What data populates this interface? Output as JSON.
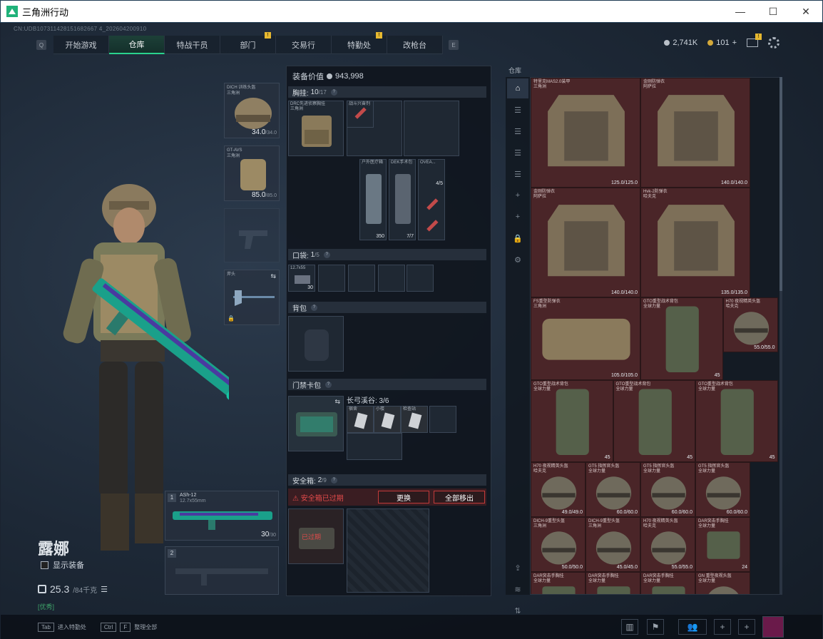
{
  "window": {
    "title": "三角洲行动",
    "min": "—",
    "max": "☐",
    "close": "✕"
  },
  "uid": "CN:UDB107311428151682667 4_202604200910",
  "nav": {
    "left_key": "Q",
    "right_key": "E",
    "tabs": [
      "开始游戏",
      "仓库",
      "特战干员",
      "部门",
      "交易行",
      "特勤处",
      "改枪台"
    ],
    "active": "仓库",
    "badges": {
      "部门": "!",
      "特勤处": "!"
    }
  },
  "currency": {
    "silver": "2,741K",
    "gold": "101",
    "plus": "+",
    "mail_badge": "!"
  },
  "character": {
    "name": "露娜",
    "show_equipment": "显示装备",
    "weight": "25.3",
    "weight_max": "/84千克",
    "green_text": "[优秀]"
  },
  "bottom": {
    "hint1_key": "Tab",
    "hint1": "进入特勤处",
    "hint2_key": "Ctrl",
    "hint2_key2": "F",
    "hint2": "整理全部"
  },
  "equip": {
    "helmet": {
      "label": "DICH 训练头盔\n三角洲",
      "value": "34.0",
      "max": "/34.0"
    },
    "armor": {
      "label": "GT-AVS\n三角洲",
      "value": "85.0",
      "max": "/85.0"
    },
    "melee": {
      "label": "斧头"
    },
    "weapon1": {
      "slot": "1",
      "name": "ASh-12",
      "ammo_type": "12.7x55mm",
      "ammo": "30",
      "ammo_max": "/30"
    },
    "weapon2": {
      "slot": "2"
    }
  },
  "panel": {
    "value_label": "装备价值",
    "value": "943,998",
    "chest": {
      "title": "胸挂:",
      "count": "10",
      "max": "/17"
    },
    "chest_item": "DRC先进侦察胸挂\n三角洲",
    "chest_small": [
      {
        "label": "战斗兴奋剂"
      },
      {
        "label": "户外医疗箱",
        "num": "350"
      },
      {
        "label": "DEK手术包",
        "num": "7/7"
      },
      {
        "label": "OVEA...",
        "num": "4/5"
      }
    ],
    "pocket": {
      "title": "口袋:",
      "count": "1",
      "max": "/5",
      "item": "12.7x55",
      "num": "30"
    },
    "backpack": {
      "title": "背包"
    },
    "keycard": {
      "title": "门禁卡包",
      "sub": "长弓溪谷: 3/6",
      "items": [
        "宿舍",
        "小楼",
        "检查站"
      ]
    },
    "safebox": {
      "title": "安全箱:",
      "count": "2",
      "max": "/9",
      "expired": "安全箱已过期",
      "replace": "更换",
      "remove_all": "全部移出",
      "overlay": "已过期"
    }
  },
  "inventory": {
    "title": "仓库",
    "items": [
      {
        "label": "特里克MAS2.0装甲\n三角洲",
        "num": "125.0/125.0"
      },
      {
        "label": "金刚防弹衣\n阿萨拉",
        "num": "140.0/140.0"
      },
      {
        "label": "金刚防弹衣\n阿萨拉",
        "num": "140.0/140.0"
      },
      {
        "label": "Hvk-2防弹衣\n哈夫克",
        "num": "135.0/135.0"
      },
      {
        "label": "FS重型防弹衣\n三角洲",
        "num": "105.0/105.0"
      },
      {
        "label": "GTO重型战术背包\n全球力量",
        "num": "45"
      },
      {
        "label": "H70 夜视精英头盔\n哈夫克",
        "num": "55.0/55.0"
      },
      {
        "label": "GTO重型战术背包\n全球力量",
        "num": "45"
      },
      {
        "label": "GTO重型战术背包\n全球力量",
        "num": "45"
      },
      {
        "label": "GTO重型战术背包\n全球力量",
        "num": "45"
      },
      {
        "label": "H70 夜视精英头盔\n哈夫克",
        "num": "49.0/49.0"
      },
      {
        "label": "GT5 指挥官头盔\n全球力量",
        "num": "60.0/60.0"
      },
      {
        "label": "GT5 指挥官头盔\n全球力量",
        "num": "60.0/60.0"
      },
      {
        "label": "GT5 指挥官头盔\n全球力量",
        "num": "60.0/60.0"
      },
      {
        "label": "DICH-9重型头盔\n三角洲",
        "num": "50.0/50.0"
      },
      {
        "label": "DICH-9重型头盔\n三角洲",
        "num": "45.0/45.0"
      },
      {
        "label": "H70 夜视精英头盔\n哈夫克",
        "num": "55.0/55.0"
      },
      {
        "label": "DAR突击手胸挂\n全球力量",
        "num": "24"
      },
      {
        "label": "DAR突击手胸挂\n全球力量",
        "num": ""
      },
      {
        "label": "DAR突击手胸挂\n全球力量",
        "num": ""
      },
      {
        "label": "DAR突击手胸挂\n全球力量",
        "num": ""
      },
      {
        "label": "GN 重型夜视头盔\n全球力量",
        "num": ""
      }
    ],
    "side_icons": [
      "home-icon",
      "list-icon",
      "list-icon",
      "list-icon",
      "list-icon",
      "plus-icon",
      "plus-icon",
      "lock-icon",
      "gear-icon"
    ],
    "bottom_icons": [
      "upload-icon",
      "layers-icon",
      "sort-icon"
    ]
  },
  "colors": {
    "accent": "#2ad38e",
    "red_bg": "#4a2528",
    "warn": "#e04a4a",
    "badge": "#e6b830"
  }
}
